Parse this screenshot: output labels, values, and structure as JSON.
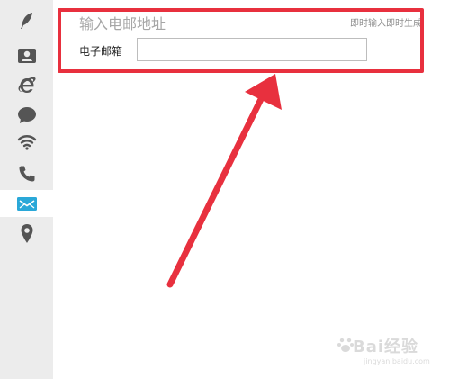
{
  "sidebar": {
    "items": [
      {
        "icon": "feather-icon",
        "active": false
      },
      {
        "icon": "contact-card-icon",
        "active": false
      },
      {
        "icon": "browser-e-icon",
        "active": false
      },
      {
        "icon": "chat-bubble-icon",
        "active": false
      },
      {
        "icon": "wifi-icon",
        "active": false
      },
      {
        "icon": "phone-icon",
        "active": false
      },
      {
        "icon": "email-icon",
        "active": true
      },
      {
        "icon": "location-pin-icon",
        "active": false
      }
    ]
  },
  "section": {
    "title": "输入电邮地址",
    "hint": "即时输入即时生成"
  },
  "form": {
    "email_label": "电子邮箱",
    "email_value": "",
    "email_placeholder": ""
  },
  "annotation": {
    "color": "#e8303e"
  },
  "watermark": {
    "brand": "Bai经验",
    "url": "jingyan.baidu.com"
  },
  "colors": {
    "sidebar_bg": "#ececec",
    "icon": "#555555",
    "active_icon_bg": "#2aa8d8",
    "highlight": "#e8303e"
  }
}
